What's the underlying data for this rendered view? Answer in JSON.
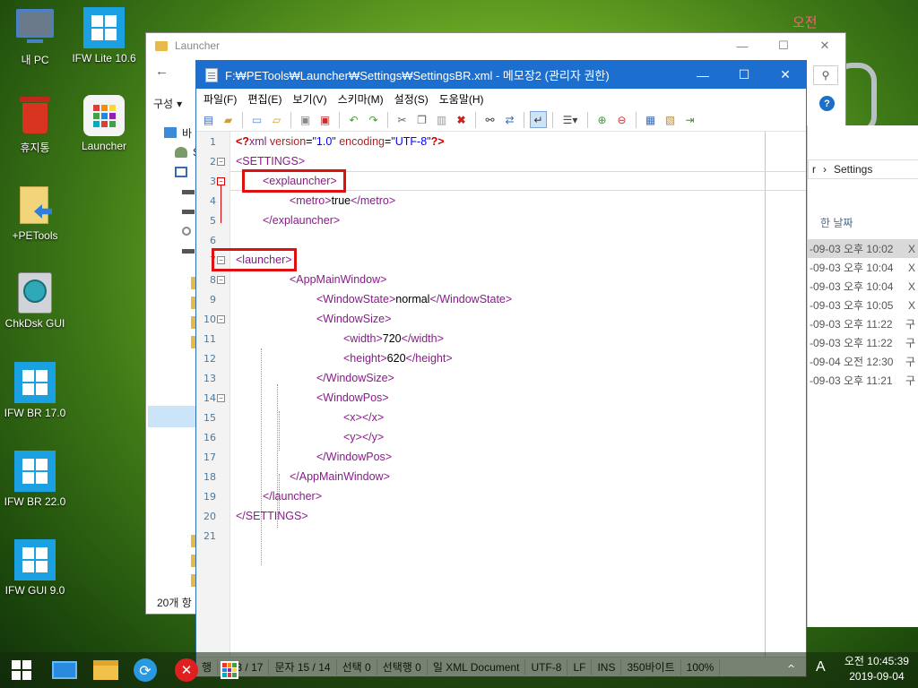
{
  "desktop": {
    "clock_label": "오전",
    "icons": [
      {
        "label": "내 PC",
        "icon": "computer-icon"
      },
      {
        "label": "IFW Lite 10.6",
        "icon": "windows-icon"
      },
      {
        "label": "휴지통",
        "icon": "recycle-bin-icon"
      },
      {
        "label": "Launcher",
        "icon": "launcher-icon"
      },
      {
        "label": "+PETools",
        "icon": "folder-shortcut-icon"
      },
      {
        "label": "ChkDsk GUI",
        "icon": "disk-check-icon"
      },
      {
        "label": "IFW BR 17.0",
        "icon": "windows-icon"
      },
      {
        "label": "IFW BR 22.0",
        "icon": "windows-icon"
      },
      {
        "label": "IFW GUI 9.0",
        "icon": "windows-icon"
      }
    ]
  },
  "explorer": {
    "title": "Launcher",
    "command_label": "구성",
    "status": "20개 항",
    "search_icon": "search-icon",
    "help_label": "?",
    "side_items": [
      "바",
      "S",
      "",
      ""
    ]
  },
  "explorer2": {
    "breadcrumb_prefix": "r",
    "breadcrumb": "Settings",
    "column_header": "한 날짜",
    "rows": [
      {
        "date": "-09-03 오후 10:02",
        "tail": "X"
      },
      {
        "date": "-09-03 오후 10:04",
        "tail": "X"
      },
      {
        "date": "-09-03 오후 10:04",
        "tail": "X"
      },
      {
        "date": "-09-03 오후 10:05",
        "tail": "X"
      },
      {
        "date": "-09-03 오후 11:22",
        "tail": "구"
      },
      {
        "date": "-09-03 오후 11:22",
        "tail": "구"
      },
      {
        "date": "-09-04 오전 12:30",
        "tail": "구"
      },
      {
        "date": "-09-03 오후 11:21",
        "tail": "구"
      }
    ]
  },
  "notepad": {
    "title": "F:₩PETools₩Launcher₩Settings₩SettingsBR.xml - 메모장2 (관리자 권한)",
    "menu": [
      "파일(F)",
      "편집(E)",
      "보기(V)",
      "스키마(M)",
      "설정(S)",
      "도움말(H)"
    ],
    "lines": [
      {
        "n": "1",
        "text": "<?xml version=\"1.0\" encoding=\"UTF-8\"?>"
      },
      {
        "n": "2",
        "text": "<SETTINGS>"
      },
      {
        "n": "3",
        "text": "<explauncher>"
      },
      {
        "n": "4",
        "text": "<metro>true</metro>"
      },
      {
        "n": "5",
        "text": "</explauncher>"
      },
      {
        "n": "6",
        "text": ""
      },
      {
        "n": "7",
        "text": "<launcher>"
      },
      {
        "n": "8",
        "text": "<AppMainWindow>"
      },
      {
        "n": "9",
        "text": "<WindowState>normal</WindowState>"
      },
      {
        "n": "10",
        "text": "<WindowSize>"
      },
      {
        "n": "11",
        "text": "<width>720</width>"
      },
      {
        "n": "12",
        "text": "<height>620</height>"
      },
      {
        "n": "13",
        "text": "</WindowSize>"
      },
      {
        "n": "14",
        "text": "<WindowPos>"
      },
      {
        "n": "15",
        "text": "<x></x>"
      },
      {
        "n": "16",
        "text": "<y></y>"
      },
      {
        "n": "17",
        "text": "</WindowPos>"
      },
      {
        "n": "18",
        "text": "</AppMainWindow>"
      },
      {
        "n": "19",
        "text": "</launcher>"
      },
      {
        "n": "20",
        "text": "</SETTINGS>"
      },
      {
        "n": "21",
        "text": ""
      }
    ],
    "status": [
      "행",
      "열 3 / 17",
      "문자 15 / 14",
      "선택 0",
      "선택행 0",
      "일 XML Document",
      "UTF-8",
      "LF",
      "INS",
      "350바이트",
      "100%"
    ]
  },
  "taskbar": {
    "time": "오전 10:45:39",
    "date": "2019-09-04",
    "lang": "A"
  },
  "colors": {
    "titlebar": "#1c6fcf",
    "xml_tag": "#8a1a8a",
    "xml_attr_name": "#b22222",
    "xml_attr_value": "#0000ff",
    "highlight_box": "#e01010"
  }
}
